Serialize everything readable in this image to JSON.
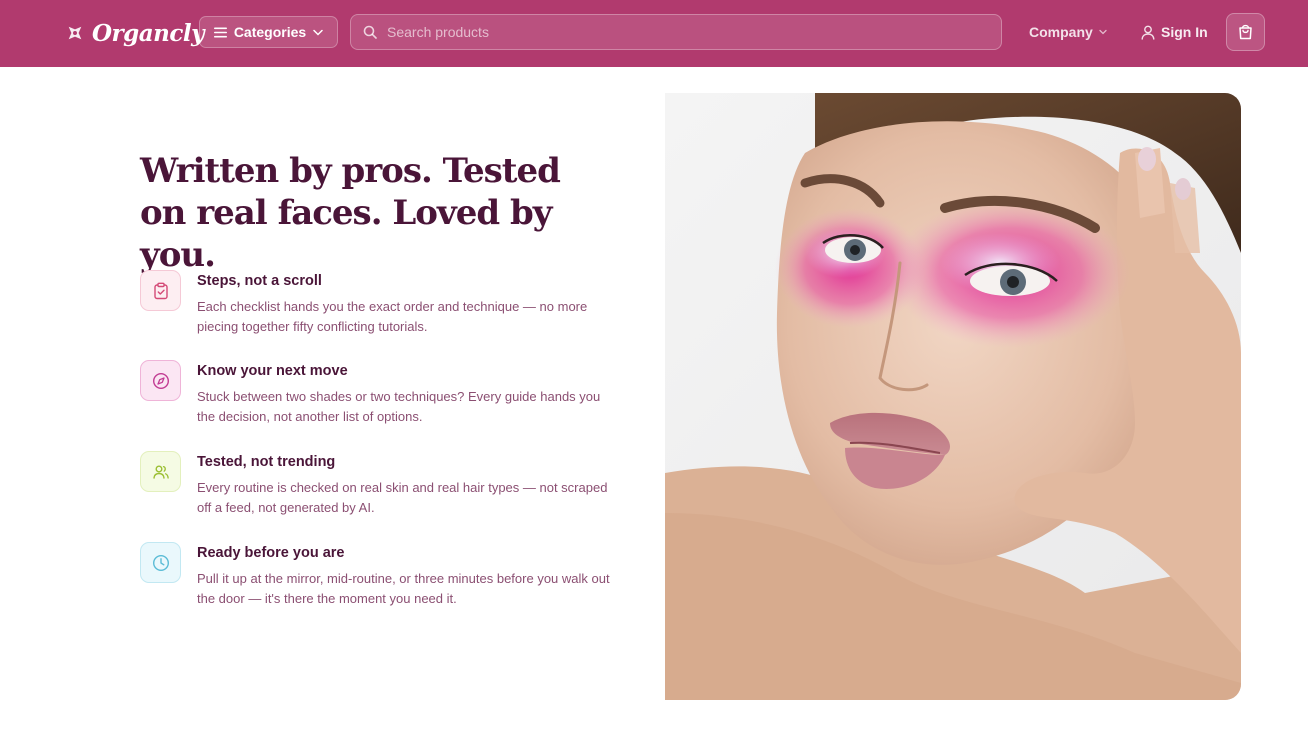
{
  "brand": {
    "name": "Organcly",
    "color": "#b13a6e",
    "heading_color": "#4a1538"
  },
  "nav": {
    "categories_label": "Categories",
    "search_placeholder": "Search products",
    "company_label": "Company",
    "signin_label": "Sign In"
  },
  "main": {
    "headline": "Written by pros. Tested on real faces. Loved by you.",
    "features": [
      {
        "icon": "clipboard-check-icon",
        "title": "Steps, not a scroll",
        "description": "Each checklist hands you the exact order and technique — no more piecing together fifty conflicting tutorials."
      },
      {
        "icon": "compass-icon",
        "title": "Know your next move",
        "description": "Stuck between two shades or two techniques? Every guide hands you the decision, not another list of options."
      },
      {
        "icon": "users-icon",
        "title": "Tested, not trending",
        "description": "Every routine is checked on real skin and real hair types — not scraped off a feed, not generated by AI."
      },
      {
        "icon": "clock-icon",
        "title": "Ready before you are",
        "description": "Pull it up at the mirror, mid-routine, or three minutes before you walk out the door — it's there the moment you need it."
      }
    ],
    "image": {
      "subject": "portrait of a woman with pink eyeshadow makeup"
    }
  }
}
